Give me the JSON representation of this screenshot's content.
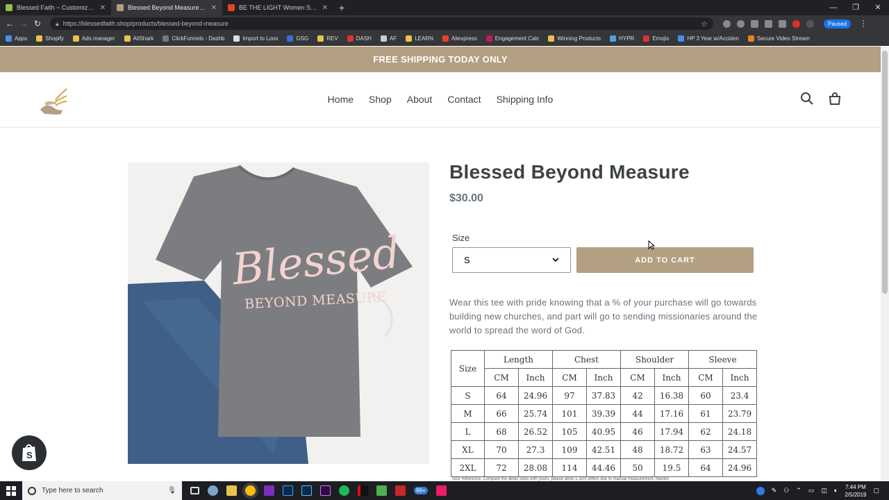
{
  "browser": {
    "tabs": [
      {
        "label": "Blessed Faith ~ Customize ~ Del",
        "color": "#95bf47",
        "active": false
      },
      {
        "label": "Blessed Beyond Measure – Bless",
        "color": "#b39f82",
        "active": true
      },
      {
        "label": "BE THE LIGHT Women Sweatshi",
        "color": "#e8431f",
        "active": false
      }
    ],
    "new_tab": "+",
    "url": "https://blessedfaith.shop/products/blessed-beyond-measure",
    "paused_label": "Paused",
    "bookmarks": [
      {
        "label": "Apps",
        "color": "#4a90e2"
      },
      {
        "label": "Shopify",
        "color": "#e8c24a"
      },
      {
        "label": "Ads manager",
        "color": "#e8c24a"
      },
      {
        "label": "AliShark",
        "color": "#e8c24a"
      },
      {
        "label": "ClickFunnels - Dashb",
        "color": "#777"
      },
      {
        "label": "Import to Loox",
        "color": "#ddd"
      },
      {
        "label": "GSG",
        "color": "#3b6ed8"
      },
      {
        "label": "REV",
        "color": "#e8c24a"
      },
      {
        "label": "DASH",
        "color": "#e03131"
      },
      {
        "label": "AF",
        "color": "#ccc"
      },
      {
        "label": "LEARN",
        "color": "#e8c24a"
      },
      {
        "label": "Aliexpress",
        "color": "#e8431f"
      },
      {
        "label": "Engagement Calc",
        "color": "#c2185b"
      },
      {
        "label": "Winning Products",
        "color": "#e8c24a"
      },
      {
        "label": "HYPR",
        "color": "#4aa3df"
      },
      {
        "label": "Emojis",
        "color": "#e03131"
      },
      {
        "label": "HP 3 Year w/Acciden",
        "color": "#4a90e2"
      },
      {
        "label": "Secure Video Stream",
        "color": "#e8831f"
      }
    ]
  },
  "store": {
    "announcement": "FREE SHIPPING TODAY ONLY",
    "nav": [
      "Home",
      "Shop",
      "About",
      "Contact",
      "Shipping Info"
    ],
    "brand_color": "#b39f82"
  },
  "product": {
    "title": "Blessed Beyond Measure",
    "price": "$30.00",
    "size_label": "Size",
    "size_selected": "S",
    "add_to_cart": "ADD TO CART",
    "description": "Wear this tee with pride knowing that a % of your purchase will go towards building new churches, and part will go to sending missionaries around the world to spread the word of God.",
    "shirt_text_line1": "Blessed",
    "shirt_text_line2": "BEYOND MEASURE",
    "size_chart": {
      "size_header": "Size",
      "groups": [
        "Length",
        "Chest",
        "Shoulder",
        "Sleeve"
      ],
      "units": [
        "CM",
        "Inch"
      ],
      "rows": [
        [
          "S",
          "64",
          "24.96",
          "97",
          "37.83",
          "42",
          "16.38",
          "60",
          "23.4"
        ],
        [
          "M",
          "66",
          "25.74",
          "101",
          "39.39",
          "44",
          "17.16",
          "61",
          "23.79"
        ],
        [
          "L",
          "68",
          "26.52",
          "105",
          "40.95",
          "46",
          "17.94",
          "62",
          "24.18"
        ],
        [
          "XL",
          "70",
          "27.3",
          "109",
          "42.51",
          "48",
          "18.72",
          "63",
          "24.57"
        ],
        [
          "2XL",
          "72",
          "28.08",
          "114",
          "44.46",
          "50",
          "19.5",
          "64",
          "24.96"
        ]
      ],
      "footnote": "Size Reference: Compare the detail sizes with yours, please allow 1-3cm differs due to manual measurement, thanks!"
    }
  },
  "taskbar": {
    "search_placeholder": "Type here to search",
    "time": "7:44 PM",
    "date": "2/5/2019",
    "badge": "99+"
  }
}
